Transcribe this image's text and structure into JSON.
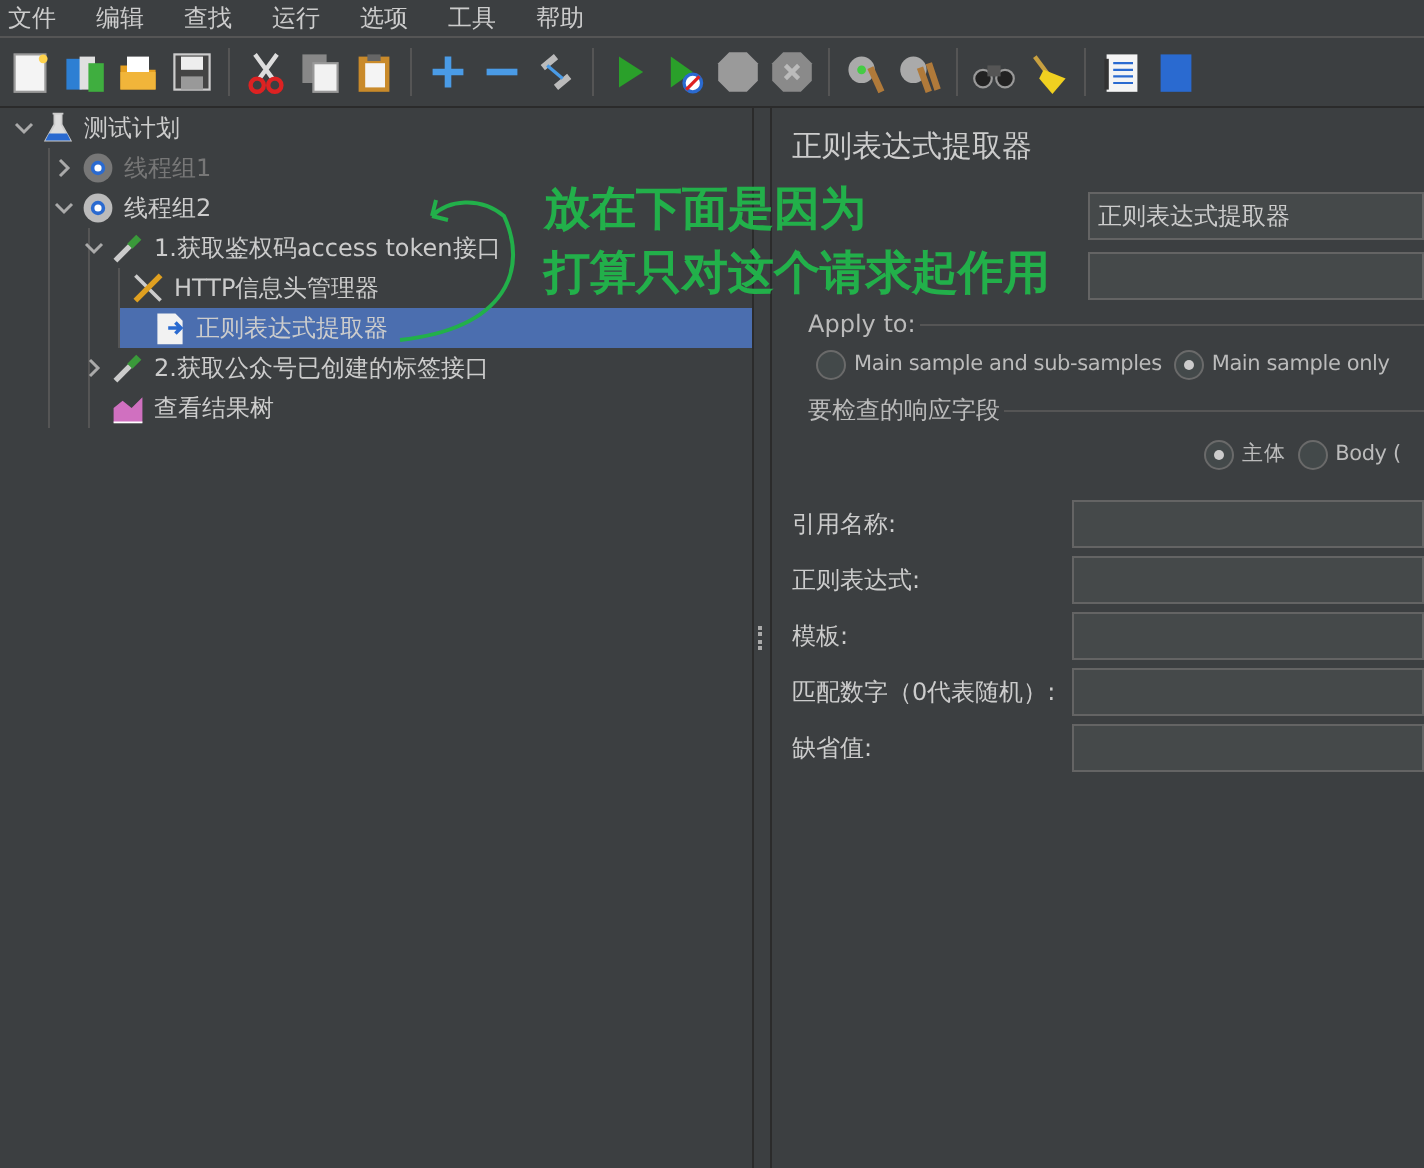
{
  "menu": [
    "文件",
    "编辑",
    "查找",
    "运行",
    "选项",
    "工具",
    "帮助"
  ],
  "tree": [
    {
      "label": "测试计划",
      "kind": "plan",
      "expanded": true,
      "disabled": false,
      "selected": false,
      "children": [
        {
          "label": "线程组1",
          "kind": "threadgroup",
          "expanded": false,
          "disabled": true,
          "selected": false
        },
        {
          "label": "线程组2",
          "kind": "threadgroup",
          "expanded": true,
          "disabled": false,
          "selected": false,
          "children": [
            {
              "label": "1.获取鉴权码access token接口",
              "kind": "sampler",
              "expanded": true,
              "disabled": false,
              "selected": false,
              "children": [
                {
                  "label": "HTTP信息头管理器",
                  "kind": "config",
                  "disabled": false,
                  "selected": false
                },
                {
                  "label": "正则表达式提取器",
                  "kind": "extractor",
                  "disabled": false,
                  "selected": true
                }
              ]
            },
            {
              "label": "2.获取公众号已创建的标签接口",
              "kind": "sampler",
              "expanded": false,
              "disabled": false,
              "selected": false
            },
            {
              "label": "查看结果树",
              "kind": "listener",
              "disabled": false,
              "selected": false
            }
          ]
        }
      ]
    }
  ],
  "annotation": [
    "放在下面是因为",
    "打算只对这个请求起作用"
  ],
  "panel": {
    "title": "正则表达式提取器",
    "name_field": {
      "value": "正则表达式提取器"
    },
    "apply_to": {
      "title": "Apply to:",
      "options": [
        {
          "label": "Main sample and sub-samples",
          "selected": false
        },
        {
          "label": "Main sample only",
          "selected": true
        }
      ]
    },
    "response_field": {
      "title": "要检查的响应字段",
      "options": [
        {
          "label": "主体",
          "selected": true
        },
        {
          "label": "Body (",
          "selected": false
        }
      ]
    },
    "fields": [
      {
        "label": "引用名称:"
      },
      {
        "label": "正则表达式:"
      },
      {
        "label": "模板:"
      },
      {
        "label": "匹配数字（0代表随机）:"
      },
      {
        "label": "缺省值:"
      }
    ]
  }
}
